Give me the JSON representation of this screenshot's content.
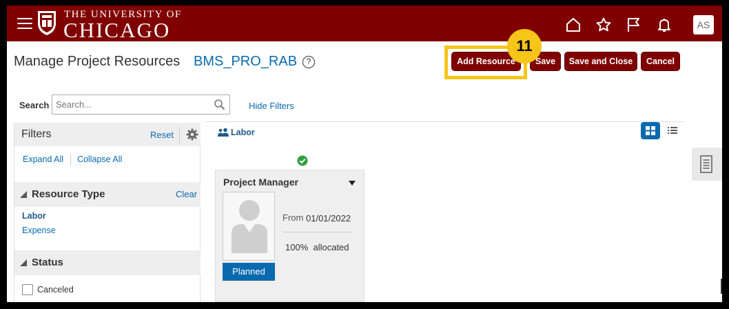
{
  "header": {
    "logo_top": "THE UNIVERSITY OF",
    "logo_bottom": "CHICAGO",
    "avatar_initials": "AS",
    "brand_color": "#800000",
    "icons": [
      "home-icon",
      "star-icon",
      "flag-icon",
      "bell-icon"
    ]
  },
  "page": {
    "title": "Manage Project Resources",
    "project_name": "BMS_PRO_RAB",
    "help_glyph": "?"
  },
  "toolbar": {
    "add_resource": "Add Resource",
    "save": "Save",
    "save_and_close": "Save and Close",
    "cancel": "Cancel"
  },
  "callout": {
    "step_number": "11",
    "color": "#f5c518"
  },
  "search": {
    "label": "Search",
    "placeholder": "Search...",
    "hide_filters": "Hide Filters"
  },
  "filters": {
    "title": "Filters",
    "reset": "Reset",
    "expand_all": "Expand All",
    "collapse_all": "Collapse All",
    "resource_type": {
      "title": "Resource Type",
      "clear": "Clear",
      "options": [
        "Labor",
        "Expense"
      ]
    },
    "status": {
      "title": "Status",
      "options": [
        "Canceled"
      ]
    }
  },
  "main": {
    "group_label": "Labor",
    "card": {
      "role": "Project Manager",
      "from_label": "From",
      "from_date": "01/01/2022",
      "allocation": "100%  allocated",
      "status": "Planned"
    }
  }
}
